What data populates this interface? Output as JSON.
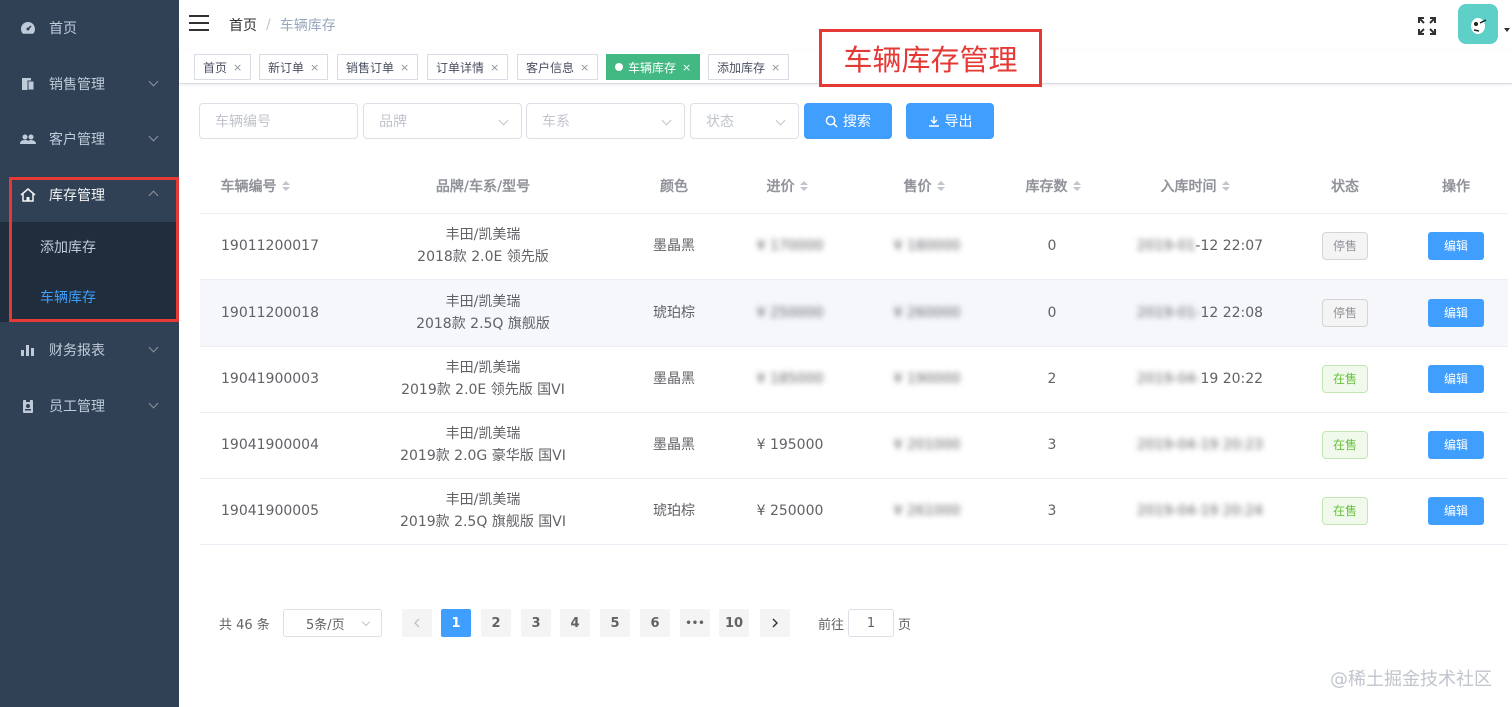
{
  "sidebar": {
    "items": [
      {
        "label": "首页",
        "icon": "dashboard-icon"
      },
      {
        "label": "销售管理",
        "icon": "document-icon"
      },
      {
        "label": "客户管理",
        "icon": "users-icon"
      },
      {
        "label": "库存管理",
        "icon": "home-icon"
      },
      {
        "label": "财务报表",
        "icon": "bar-chart-icon"
      },
      {
        "label": "员工管理",
        "icon": "badge-icon"
      }
    ],
    "submenu": [
      {
        "label": "添加库存"
      },
      {
        "label": "车辆库存"
      }
    ]
  },
  "navbar": {
    "breadcrumb": [
      "首页",
      "车辆库存"
    ],
    "separator": "/"
  },
  "tags": [
    {
      "label": "首页",
      "close": "×"
    },
    {
      "label": "新订单",
      "close": "×"
    },
    {
      "label": "销售订单",
      "close": "×"
    },
    {
      "label": "订单详情",
      "close": "×"
    },
    {
      "label": "客户信息",
      "close": "×"
    },
    {
      "label": "车辆库存",
      "close": "×"
    },
    {
      "label": "添加库存",
      "close": "×"
    }
  ],
  "annotation": "车辆库存管理",
  "filters": {
    "vehicle_no_placeholder": "车辆编号",
    "brand_placeholder": "品牌",
    "series_placeholder": "车系",
    "status_placeholder": "状态",
    "search_label": "搜索",
    "export_label": "导出"
  },
  "table": {
    "headers": [
      "车辆编号",
      "品牌/车系/型号",
      "颜色",
      "进价",
      "售价",
      "库存数",
      "入库时间",
      "状态",
      "操作"
    ],
    "rows": [
      {
        "id": "19011200017",
        "model1": "丰田/凯美瑞",
        "model2": "2018款 2.0E 领先版",
        "color": "墨晶黑",
        "purchase": "¥ 170000",
        "sale": "¥ 180000",
        "stock": "0",
        "time_hidden": "2019-01",
        "time": "-12 22:07",
        "status": "停售",
        "action": "编辑"
      },
      {
        "id": "19011200018",
        "model1": "丰田/凯美瑞",
        "model2": "2018款 2.5Q 旗舰版",
        "color": "琥珀棕",
        "purchase": "¥ 250000",
        "sale": "¥ 260000",
        "stock": "0",
        "time_hidden": "2019-01-",
        "time": "12 22:08",
        "status": "停售",
        "action": "编辑"
      },
      {
        "id": "19041900003",
        "model1": "丰田/凯美瑞",
        "model2": "2019款 2.0E 领先版 国VI",
        "color": "墨晶黑",
        "purchase": "¥ 185000",
        "sale": "¥ 190000",
        "stock": "2",
        "time_hidden": "2019-04-",
        "time": "19 20:22",
        "status": "在售",
        "action": "编辑"
      },
      {
        "id": "19041900004",
        "model1": "丰田/凯美瑞",
        "model2": "2019款 2.0G 豪华版 国VI",
        "color": "墨晶黑",
        "purchase": "¥ 195000",
        "sale": "¥ 201000",
        "stock": "3",
        "time_hidden": "2019-04-19 20:23",
        "time": "",
        "status": "在售",
        "action": "编辑"
      },
      {
        "id": "19041900005",
        "model1": "丰田/凯美瑞",
        "model2": "2019款 2.5Q 旗舰版 国VI",
        "color": "琥珀棕",
        "purchase": "¥ 250000",
        "sale": "¥ 261000",
        "stock": "3",
        "time_hidden": "2019-04-19 20:24",
        "time": "",
        "status": "在售",
        "action": "编辑"
      }
    ]
  },
  "pagination": {
    "total": "共 46 条",
    "page_size": "5条/页",
    "pages": [
      "1",
      "2",
      "3",
      "4",
      "5",
      "6",
      "•••",
      "10"
    ],
    "goto_prefix": "前往",
    "goto_value": "1",
    "goto_suffix": "页"
  },
  "watermark": "@稀土掘金技术社区",
  "colors": {
    "sidebar_bg": "#304156",
    "primary": "#409eff",
    "active_tag": "#42b983",
    "annotation_red": "#e53935"
  }
}
